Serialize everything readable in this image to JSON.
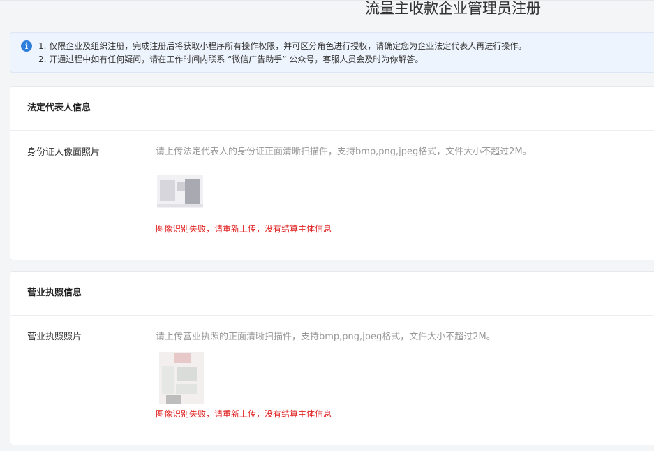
{
  "page": {
    "title": "流量主收款企业管理员注册"
  },
  "notice": {
    "icon": "info-icon",
    "icon_glyph": "i",
    "lines": [
      "1. 仅限企业及组织注册，完成注册后将获取小程序所有操作权限，并可区分角色进行授权，请确定您为企业法定代表人再进行操作。",
      "2. 开通过程中如有任何疑问，请在工作时间内联系 “微信广告助手” 公众号，客服人员会及时为你解答。"
    ]
  },
  "sections": [
    {
      "title": "法定代表人信息",
      "field_label": "身份证人像面照片",
      "hint": "请上传法定代表人的身份证正面清晰扫描件，支持bmp,png,jpeg格式，文件大小不超过2M。",
      "error": "图像识别失败，请重新上传，没有结算主体信息"
    },
    {
      "title": "营业执照信息",
      "field_label": "营业执照照片",
      "hint": "请上传营业执照的正面清晰扫描件，支持bmp,png,jpeg格式，文件大小不超过2M。",
      "error": "图像识别失败，请重新上传，没有结算主体信息"
    }
  ],
  "colors": {
    "error": "#e02020",
    "info_icon": "#2f7ddb",
    "notice_bg": "#eef4fd"
  }
}
